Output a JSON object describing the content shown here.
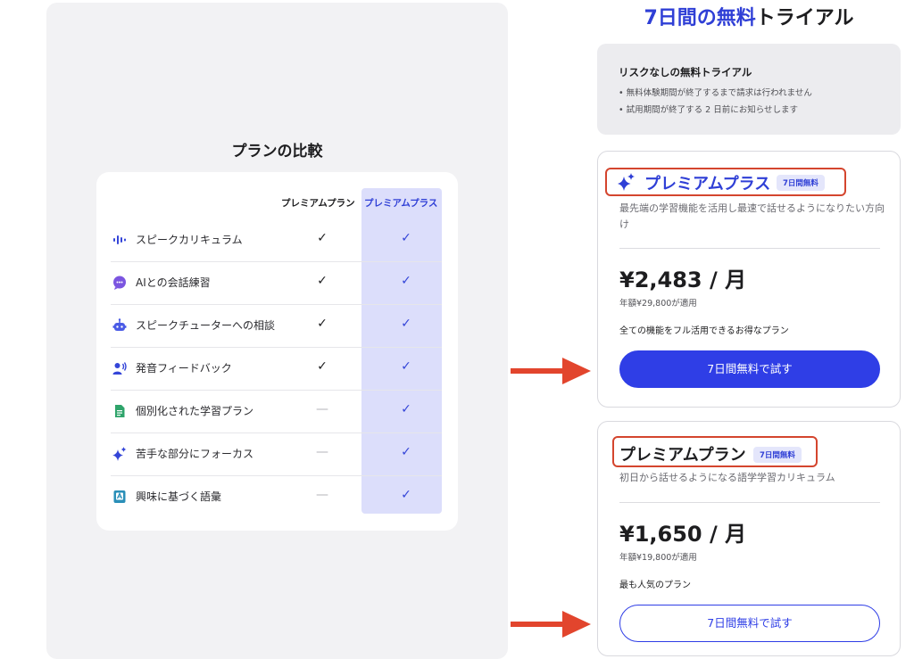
{
  "comparison": {
    "title": "プランの比較",
    "columns": {
      "premium": "プレミアムプラン",
      "plus": "プレミアムプラス"
    },
    "rows": [
      {
        "icon": "speak-curriculum-icon",
        "label": "スピークカリキュラム",
        "premium": "✓",
        "plus": "✓"
      },
      {
        "icon": "ai-chat-icon",
        "label": "AIとの会話練習",
        "premium": "✓",
        "plus": "✓"
      },
      {
        "icon": "robot-tutor-icon",
        "label": "スピークチューターへの相談",
        "premium": "✓",
        "plus": "✓"
      },
      {
        "icon": "speaking-person-icon",
        "label": "発音フィードバック",
        "premium": "✓",
        "plus": "✓"
      },
      {
        "icon": "document-icon",
        "label": "個別化された学習プラン",
        "premium": "—",
        "plus": "✓"
      },
      {
        "icon": "sparkle-icon",
        "label": "苦手な部分にフォーカス",
        "premium": "—",
        "plus": "✓"
      },
      {
        "icon": "vocabulary-icon",
        "label": "興味に基づく語彙",
        "premium": "—",
        "plus": "✓"
      }
    ]
  },
  "trial": {
    "heading_accent": "7日間の無料",
    "heading_rest": "トライアル",
    "risk": {
      "title": "リスクなしの無料トライアル",
      "items": [
        "• 無料体験期間が終了するまで請求は行われません",
        "• 試用期間が終了する 2 日前にお知らせします"
      ]
    }
  },
  "plans": {
    "plus": {
      "name": "プレミアムプラス",
      "badge": "7日間無料",
      "description": "最先端の学習機能を活用し最速で話せるようになりたい方向け",
      "price": "¥2,483 / 月",
      "annual": "年額¥29,800が適用",
      "tagline": "全ての機能をフル活用できるお得なプラン",
      "cta": "7日間無料で試す"
    },
    "premium": {
      "name": "プレミアムプラン",
      "badge": "7日間無料",
      "description": "初日から話せるようになる語学学習カリキュラム",
      "price": "¥1,650 / 月",
      "annual": "年額¥19,800が適用",
      "tagline": "最も人気のプラン",
      "cta": "7日間無料で試す"
    }
  },
  "colors": {
    "accent": "#2f3fd6",
    "annotation_red": "#d4452e",
    "arrow_red": "#e2452d",
    "plus_column": "#dcdefb"
  }
}
